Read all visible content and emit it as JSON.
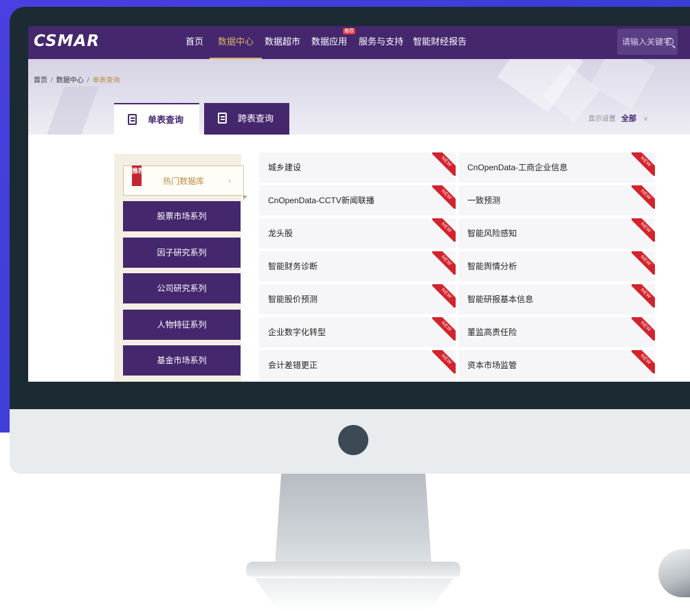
{
  "nav": {
    "logo": "CSMAR",
    "items": [
      {
        "label": "首页"
      },
      {
        "label": "数据中心"
      },
      {
        "label": "数据超市"
      },
      {
        "label": "数据应用",
        "badge": "推荐"
      },
      {
        "label": "服务与支持"
      },
      {
        "label": "智能财经报告"
      }
    ],
    "search_placeholder": "请输入关键字"
  },
  "breadcrumb": {
    "home": "首页",
    "sep1": "/",
    "section": "数据中心",
    "sep2": "/",
    "current": "单表查询"
  },
  "tabs": {
    "single": "单表查询",
    "cross": "跨表查询"
  },
  "display_setting": {
    "label": "显示设置",
    "value": "全部",
    "chevron": "∨"
  },
  "categories": {
    "hot_badge": "推荐",
    "hot_label": "热门数据库",
    "hot_arrow": "›",
    "items": [
      "股票市场系列",
      "因子研究系列",
      "公司研究系列",
      "人物特征系列",
      "基金市场系列"
    ]
  },
  "new_tag": "NEW",
  "datasets": [
    "城乡建设",
    "CnOpenData-工商企业信息",
    "CnOpenData-CCTV新闻联播",
    "一致预测",
    "龙头股",
    "智能风险感知",
    "智能财务诊断",
    "智能舆情分析",
    "智能股价预测",
    "智能研报基本信息",
    "企业数字化转型",
    "董监高责任险",
    "会计差错更正",
    "资本市场监管"
  ],
  "colors": {
    "brand_purple": "#45276e",
    "accent_gold": "#d9b26a",
    "new_red": "#d3232c"
  }
}
